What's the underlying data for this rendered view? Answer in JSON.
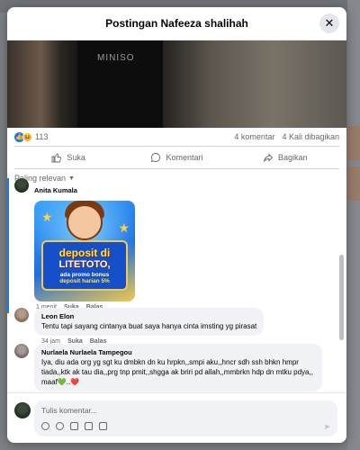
{
  "modal": {
    "title": "Postingan Nafeeza shalihah",
    "close_glyph": "✕"
  },
  "post": {
    "image_brand": "MINISO"
  },
  "stats": {
    "reaction_count": "113",
    "comments": "4 komentar",
    "shares": "4 Kali dibagikan",
    "like_glyph": "👍",
    "haha_glyph": "😆"
  },
  "actions": {
    "like": "Suka",
    "comment": "Komentari",
    "share": "Bagikan",
    "like_icon": "thumbs-up-icon",
    "comment_icon": "comment-icon",
    "share_icon": "share-icon"
  },
  "sort": {
    "label": "Paling relevan",
    "chevron": "▼"
  },
  "comments": [
    {
      "name": "Anita Kumala",
      "text": "",
      "time": "1 menit",
      "like": "Suka",
      "reply": "Balas",
      "promo": {
        "line1": "deposit di",
        "line2": "LITETOTO,",
        "line3": "ada promo bonus",
        "line4": "deposit harian 5%"
      }
    },
    {
      "name": "Leon Elon",
      "text": "Tentu tapi sayang cintanya buat saya hanya cinta imsting yg pirasat",
      "time": "34 jam",
      "like": "Suka",
      "reply": "Balas"
    },
    {
      "name": "Nurlaela Nurlaela Tampegou",
      "text": "Iya, diu ada org yg sgt ku dmbkn dn ku hrpkn,,smpi aku,,hncr sdh ssh bhkn hmpr tiada,,ktk ak tau dia,,prg tnp pmit,,shgga ak briri pd allah,,mmbrkn hdp dn mtku pdya,, maaf💚..❤️",
      "time": "",
      "like": "",
      "reply": ""
    }
  ],
  "composer": {
    "placeholder": "Tulis komentar...",
    "send_glyph": "➤"
  },
  "colors": {
    "accent": "#1877f2",
    "bubble": "#f0f2f5",
    "muted_text": "#65676b"
  }
}
